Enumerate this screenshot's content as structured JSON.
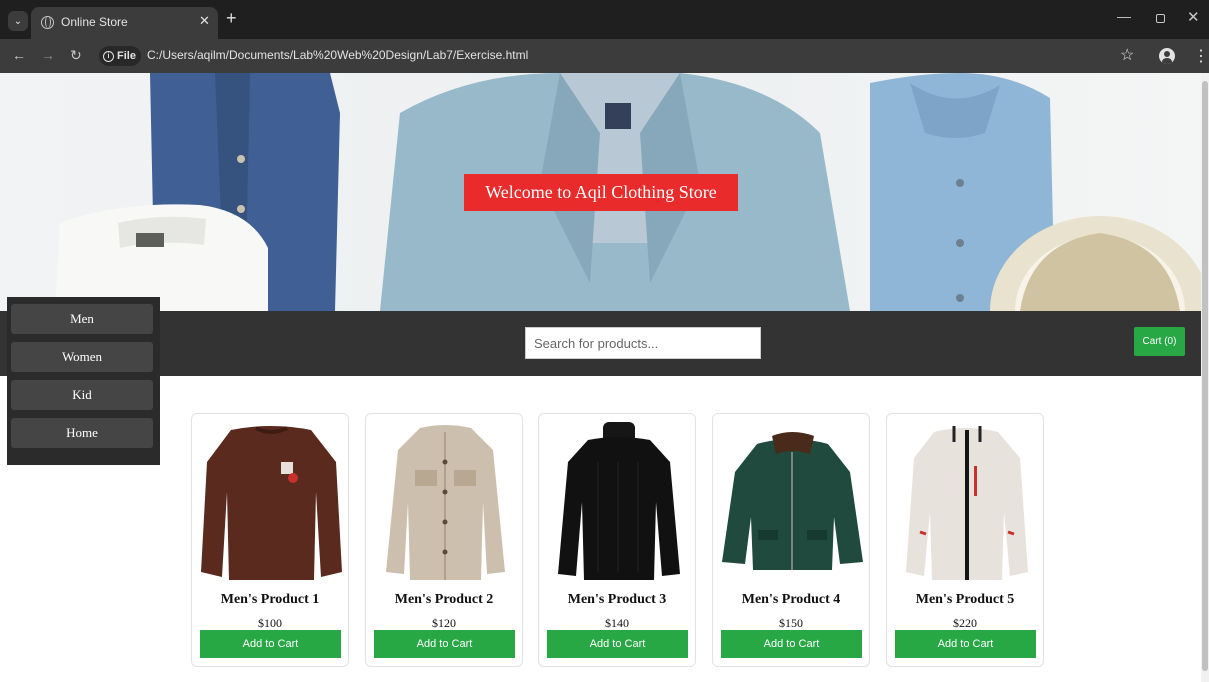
{
  "browser": {
    "tab_title": "Online Store",
    "file_chip": "File",
    "url": "C:/Users/aqilm/Documents/Lab%20Web%20Design/Lab7/Exercise.html"
  },
  "hero": {
    "title": "Welcome to Aqil Clothing Store"
  },
  "toolbar": {
    "search_placeholder": "Search for products...",
    "cart_label": "Cart (0)"
  },
  "sidebar": {
    "items": [
      {
        "label": "Men"
      },
      {
        "label": "Women"
      },
      {
        "label": "Kid"
      },
      {
        "label": "Home"
      }
    ]
  },
  "products": [
    {
      "name": "Men's Product 1",
      "price": "$100",
      "button": "Add to Cart",
      "image_color": "#5a2a1e"
    },
    {
      "name": "Men's Product 2",
      "price": "$120",
      "button": "Add to Cart",
      "image_color": "#cdbfae"
    },
    {
      "name": "Men's Product 3",
      "price": "$140",
      "button": "Add to Cart",
      "image_color": "#111111"
    },
    {
      "name": "Men's Product 4",
      "price": "$150",
      "button": "Add to Cart",
      "image_color": "#1f4a3d"
    },
    {
      "name": "Men's Product 5",
      "price": "$220",
      "button": "Add to Cart",
      "image_color": "#e8e2dd"
    }
  ],
  "colors": {
    "accent_green": "#28a745",
    "hero_banner_red": "#ea2b2b",
    "toolbar_dark": "#333333"
  }
}
